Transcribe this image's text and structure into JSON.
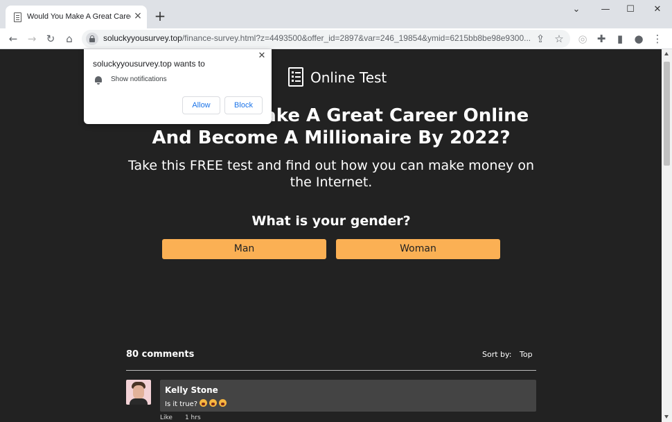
{
  "tab": {
    "title": "Would You Make A Great Career Online"
  },
  "toolbar": {
    "url_host": "soluckyyousurvey.top",
    "url_path": "/finance-survey.html?z=4493500&offer_id=2897&var=246_19854&ymid=6215bb8be98e9300..."
  },
  "notification": {
    "title": "soluckyyousurvey.top wants to",
    "permission": "Show notifications",
    "allow_label": "Allow",
    "block_label": "Block"
  },
  "page": {
    "brand": "Online Test",
    "headline": "Would You Make A Great Career Online And Become A Millionaire By 2022?",
    "subheadline": "Take this FREE test and find out how you can make money on the Internet.",
    "question": "What is your gender?",
    "options": [
      "Man",
      "Woman"
    ]
  },
  "comments": {
    "count_label": "80 comments",
    "sort_label": "Sort by:",
    "sort_value": "Top",
    "items": [
      {
        "author": "Kelly Stone",
        "text": "Is it true?",
        "like_label": "Like",
        "time": "1 hrs"
      }
    ]
  },
  "colors": {
    "accent": "#fbb054",
    "page_bg": "#222222",
    "comment_bg": "#444444"
  }
}
